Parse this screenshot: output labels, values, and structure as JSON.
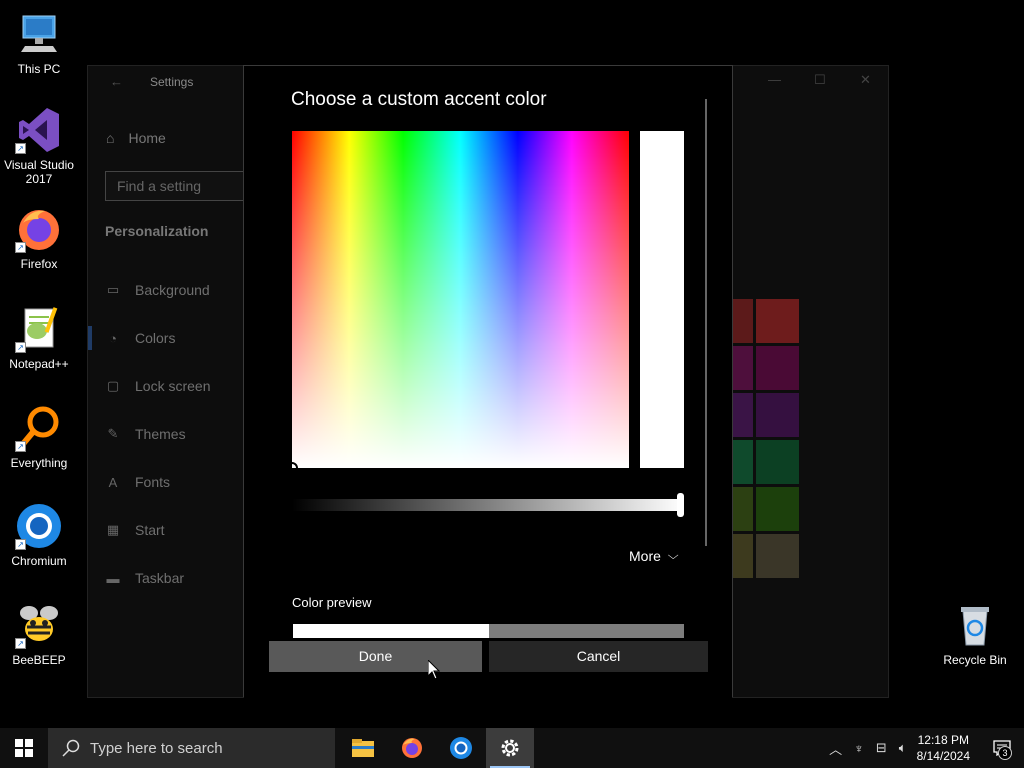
{
  "desktop": {
    "icons": [
      {
        "label": "This PC",
        "icon": "this-pc-icon"
      },
      {
        "label": "Visual Studio 2017",
        "icon": "visual-studio-icon"
      },
      {
        "label": "Firefox",
        "icon": "firefox-icon"
      },
      {
        "label": "Notepad++",
        "icon": "notepadpp-icon"
      },
      {
        "label": "Everything",
        "icon": "everything-icon"
      },
      {
        "label": "Chromium",
        "icon": "chromium-icon"
      },
      {
        "label": "BeeBEEP",
        "icon": "beebeep-icon"
      },
      {
        "label": "Recycle Bin",
        "icon": "recycle-bin-icon"
      }
    ]
  },
  "settings": {
    "title": "Settings",
    "home_label": "Home",
    "search_placeholder": "Find a setting",
    "section_title": "Personalization",
    "nav_items": [
      {
        "label": "Background",
        "icon": "picture-icon"
      },
      {
        "label": "Colors",
        "icon": "palette-icon",
        "selected": true
      },
      {
        "label": "Lock screen",
        "icon": "lock-screen-icon"
      },
      {
        "label": "Themes",
        "icon": "brush-icon"
      },
      {
        "label": "Fonts",
        "icon": "font-icon"
      },
      {
        "label": "Start",
        "icon": "start-icon"
      },
      {
        "label": "Taskbar",
        "icon": "taskbar-icon"
      }
    ],
    "swatch_colors": [
      [
        "#5c1a1a",
        "#6e1c1c"
      ],
      [
        "#4e0f3c",
        "#4a0a35"
      ],
      [
        "#3a1446",
        "#351040"
      ],
      [
        "#0f4a2c",
        "#0c4023"
      ],
      [
        "#2c4012",
        "#1c400c"
      ],
      [
        "#3d3a1e",
        "#3a3628"
      ]
    ]
  },
  "dialog": {
    "title": "Choose a custom accent color",
    "selected_color": "#ffffff",
    "brightness_percent": 100,
    "more_label": "More",
    "preview_label": "Color preview",
    "preview_new_color": "#ffffff",
    "preview_old_color": "#7d7d7d",
    "done_label": "Done",
    "cancel_label": "Cancel"
  },
  "taskbar": {
    "search_placeholder": "Type here to search",
    "apps": [
      {
        "name": "file-explorer-icon"
      },
      {
        "name": "firefox-icon"
      },
      {
        "name": "chromium-icon"
      },
      {
        "name": "settings-gear-icon",
        "active": true
      }
    ],
    "time": "12:18 PM",
    "date": "8/14/2024",
    "notification_count": "3"
  }
}
